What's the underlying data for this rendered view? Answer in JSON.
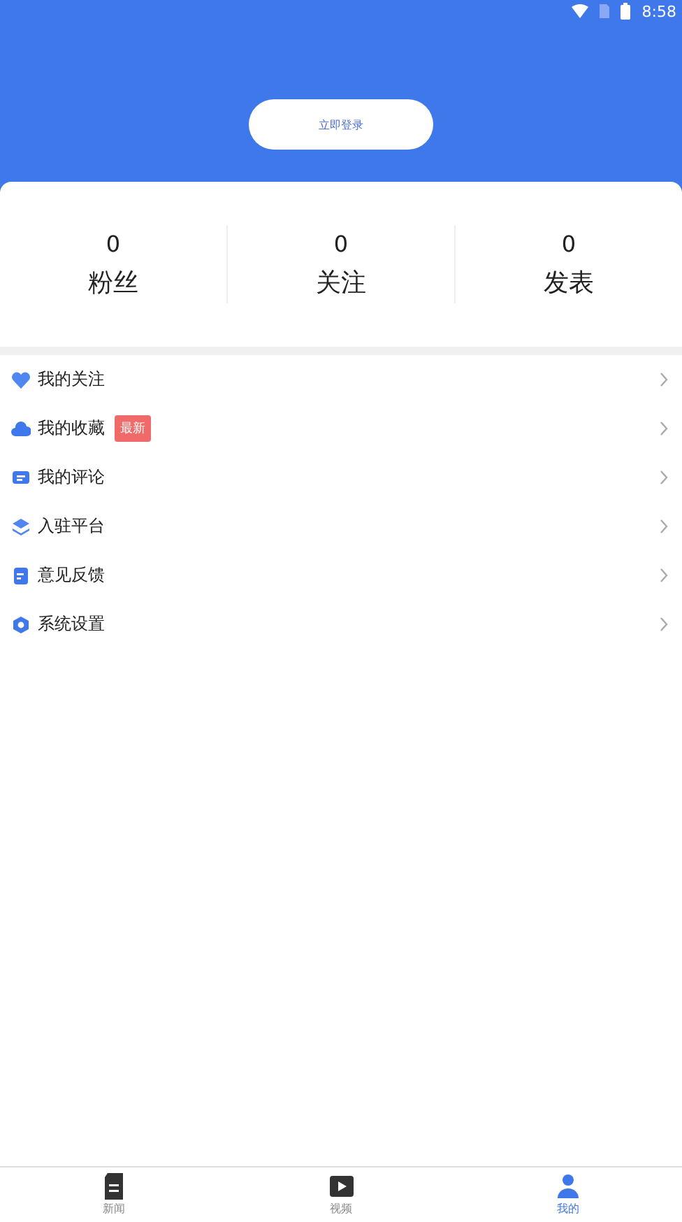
{
  "status_bar": {
    "time": "8:58"
  },
  "login_button": "立即登录",
  "stats": [
    {
      "value": "0",
      "label": "粉丝"
    },
    {
      "value": "0",
      "label": "关注"
    },
    {
      "value": "0",
      "label": "发表"
    }
  ],
  "menu": [
    {
      "kind": "heart",
      "label": "我的关注"
    },
    {
      "kind": "cloud",
      "label": "我的收藏",
      "badge": "最新"
    },
    {
      "kind": "comment",
      "label": "我的评论"
    },
    {
      "kind": "layers",
      "label": "入驻平台"
    },
    {
      "kind": "document",
      "label": "意见反馈"
    },
    {
      "kind": "settings",
      "label": "系统设置"
    }
  ],
  "tabs": [
    {
      "kind": "news",
      "label": "新闻",
      "selected": false
    },
    {
      "kind": "video",
      "label": "视频",
      "selected": false
    },
    {
      "kind": "profile",
      "label": "我的",
      "selected": true
    }
  ]
}
